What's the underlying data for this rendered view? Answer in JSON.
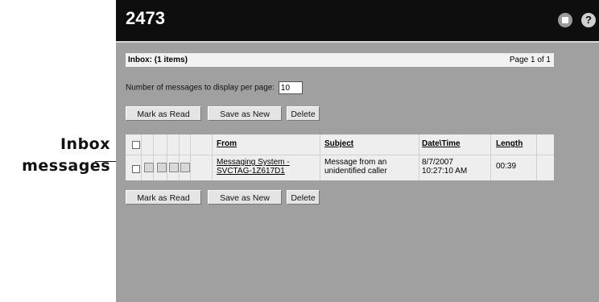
{
  "callout": {
    "line1": "Inbox",
    "line2": "messages"
  },
  "window": {
    "title": "2473",
    "icon_left": "window-icon",
    "help_label": "?"
  },
  "inbox": {
    "header": "Inbox: (1 items)",
    "page": "Page 1 of 1"
  },
  "per_page": {
    "label": "Number of messages to display per page:",
    "value": "10"
  },
  "buttons": {
    "mark_read": "Mark as Read",
    "save_new": "Save as New",
    "delete": "Delete"
  },
  "table": {
    "columns": {
      "from": "From",
      "subject": "Subject",
      "datetime": "Date\\Time",
      "length": "Length"
    },
    "rows": [
      {
        "from_line1": "Messaging System -",
        "from_line2": "SVCTAG-1Z617D1",
        "subject_line1": "Message from an",
        "subject_line2": "unidentified caller",
        "date": "8/7/2007",
        "time": "10:27:10 AM",
        "length": "00:39"
      }
    ]
  }
}
